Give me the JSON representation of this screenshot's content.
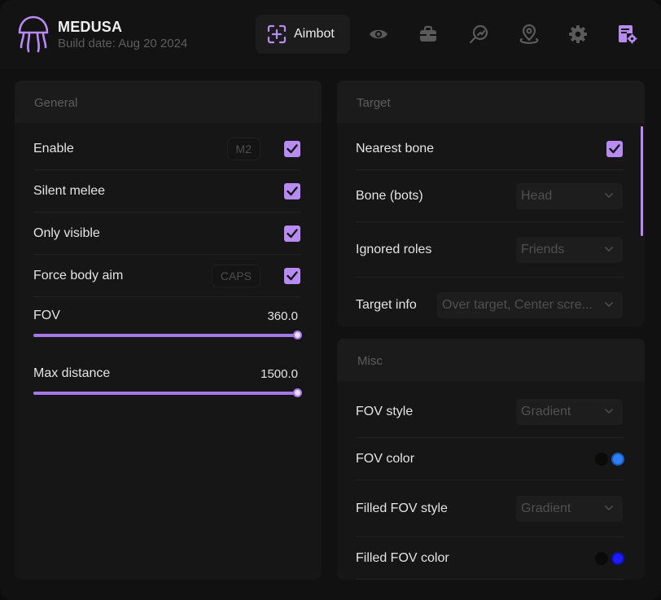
{
  "app": {
    "name": "MEDUSA",
    "build": "Build date: Aug 20 2024"
  },
  "colors": {
    "accent": "#b88bf3",
    "track": "#a679e9",
    "fov_color": "#2d7ff2",
    "filled_fov_color": "#1a1bff",
    "black": "#0a0a0a"
  },
  "nav": {
    "active_label": "Aimbot",
    "icons": [
      "aimbot-icon",
      "eye-icon",
      "briefcase-icon",
      "radar-search-icon",
      "map-pin-icon",
      "gear-icon",
      "config-list-icon"
    ]
  },
  "general": {
    "title": "General",
    "enable": {
      "label": "Enable",
      "key": "M2",
      "checked": true
    },
    "silent_melee": {
      "label": "Silent melee",
      "checked": true
    },
    "only_visible": {
      "label": "Only visible",
      "checked": true
    },
    "force_body_aim": {
      "label": "Force body aim",
      "key": "CAPS",
      "checked": true
    },
    "fov": {
      "label": "FOV",
      "value": "360.0",
      "fraction": 1.0
    },
    "max_distance": {
      "label": "Max distance",
      "value": "1500.0",
      "fraction": 1.0
    }
  },
  "target": {
    "title": "Target",
    "nearest_bone": {
      "label": "Nearest bone",
      "checked": true
    },
    "bone_bots": {
      "label": "Bone (bots)",
      "value": "Head"
    },
    "ignored_roles": {
      "label": "Ignored roles",
      "value": "Friends"
    },
    "target_info": {
      "label": "Target info",
      "value": "Over target, Center scre..."
    }
  },
  "misc": {
    "title": "Misc",
    "fov_style": {
      "label": "FOV style",
      "value": "Gradient"
    },
    "fov_color": {
      "label": "FOV color"
    },
    "filled_fov_style": {
      "label": "Filled FOV style",
      "value": "Gradient"
    },
    "filled_fov_color": {
      "label": "Filled FOV color"
    }
  }
}
